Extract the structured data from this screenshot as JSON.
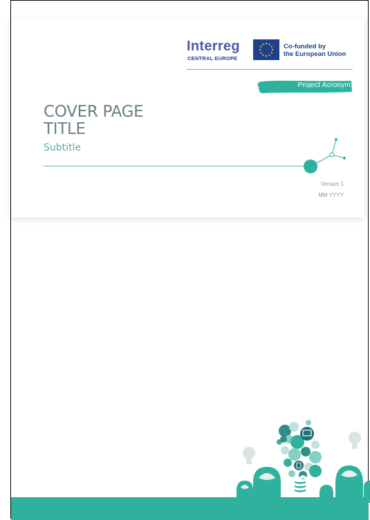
{
  "logos": {
    "interreg_name": "Interreg",
    "interreg_programme": "CENTRAL EUROPE",
    "eu_line1": "Co-funded by",
    "eu_line2": "the European Union"
  },
  "project_acronym": "Project Acronym",
  "cover": {
    "title_line1": "COVER PAGE",
    "title_line2": "TITLE",
    "subtitle": "Subtitle",
    "version": "Version 1",
    "date": "MM YYYY"
  },
  "colors": {
    "accent_teal": "#2fb29d",
    "title_grey": "#6a7f86",
    "interreg_blue": "#4d5aa8",
    "eu_blue": "#1f3f8f",
    "eu_star_yellow": "#f5d000"
  },
  "icons": [
    "eu-flag-icon",
    "network-node-icon",
    "lightbulb-heads-illustration",
    "laptop-icon",
    "cloud-icon",
    "phone-icon",
    "idea-bulb-icon"
  ]
}
